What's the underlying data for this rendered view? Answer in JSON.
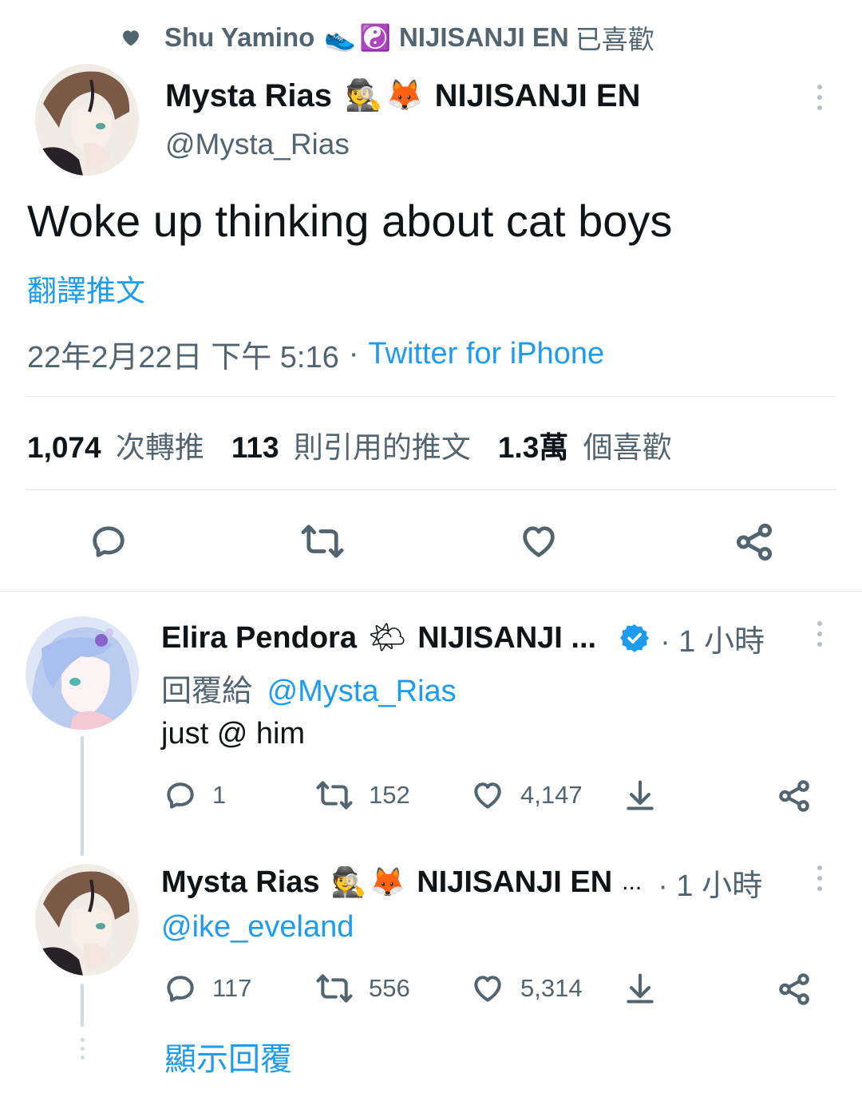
{
  "social_context": {
    "name": "Shu Yamino",
    "emoji_1": "👟",
    "emoji_2": "☯️",
    "org": "NIJISANJI EN",
    "suffix": "已喜歡"
  },
  "main_tweet": {
    "display_name": "Mysta Rias",
    "emoji_1": "🕵",
    "emoji_2": "🦊",
    "org": "NIJISANJI EN",
    "handle": "@Mysta_Rias",
    "text": "Woke up thinking about cat boys",
    "translate_label": "翻譯推文",
    "timestamp": "22年2月22日 下午 5:16",
    "separator": "·",
    "source": "Twitter for iPhone",
    "stats": {
      "retweets_value": "1,074",
      "retweets_label": "次轉推",
      "quotes_value": "113",
      "quotes_label": "則引用的推文",
      "likes_value": "1.3萬",
      "likes_label": "個喜歡"
    }
  },
  "replies": [
    {
      "display_name": "Elira Pendora",
      "emoji": "🌤",
      "org": "NIJISANJI ...",
      "verified": true,
      "time": "· 1 小時",
      "reply_to_prefix": "回覆給",
      "reply_to_handle": "@Mysta_Rias",
      "text": "just @ him",
      "replies": "1",
      "retweets": "152",
      "likes": "4,147"
    },
    {
      "display_name": "Mysta Rias",
      "emoji_1": "🕵",
      "emoji_2": "🦊",
      "org": "NIJISANJI EN",
      "ellipsis": "...",
      "time": "· 1 小時",
      "text": "@ike_eveland",
      "replies": "117",
      "retweets": "556",
      "likes": "5,314"
    }
  ],
  "show_replies_label": "顯示回覆",
  "colors": {
    "accent": "#1d9bf0",
    "text": "#0f1419",
    "secondary": "#536471"
  }
}
